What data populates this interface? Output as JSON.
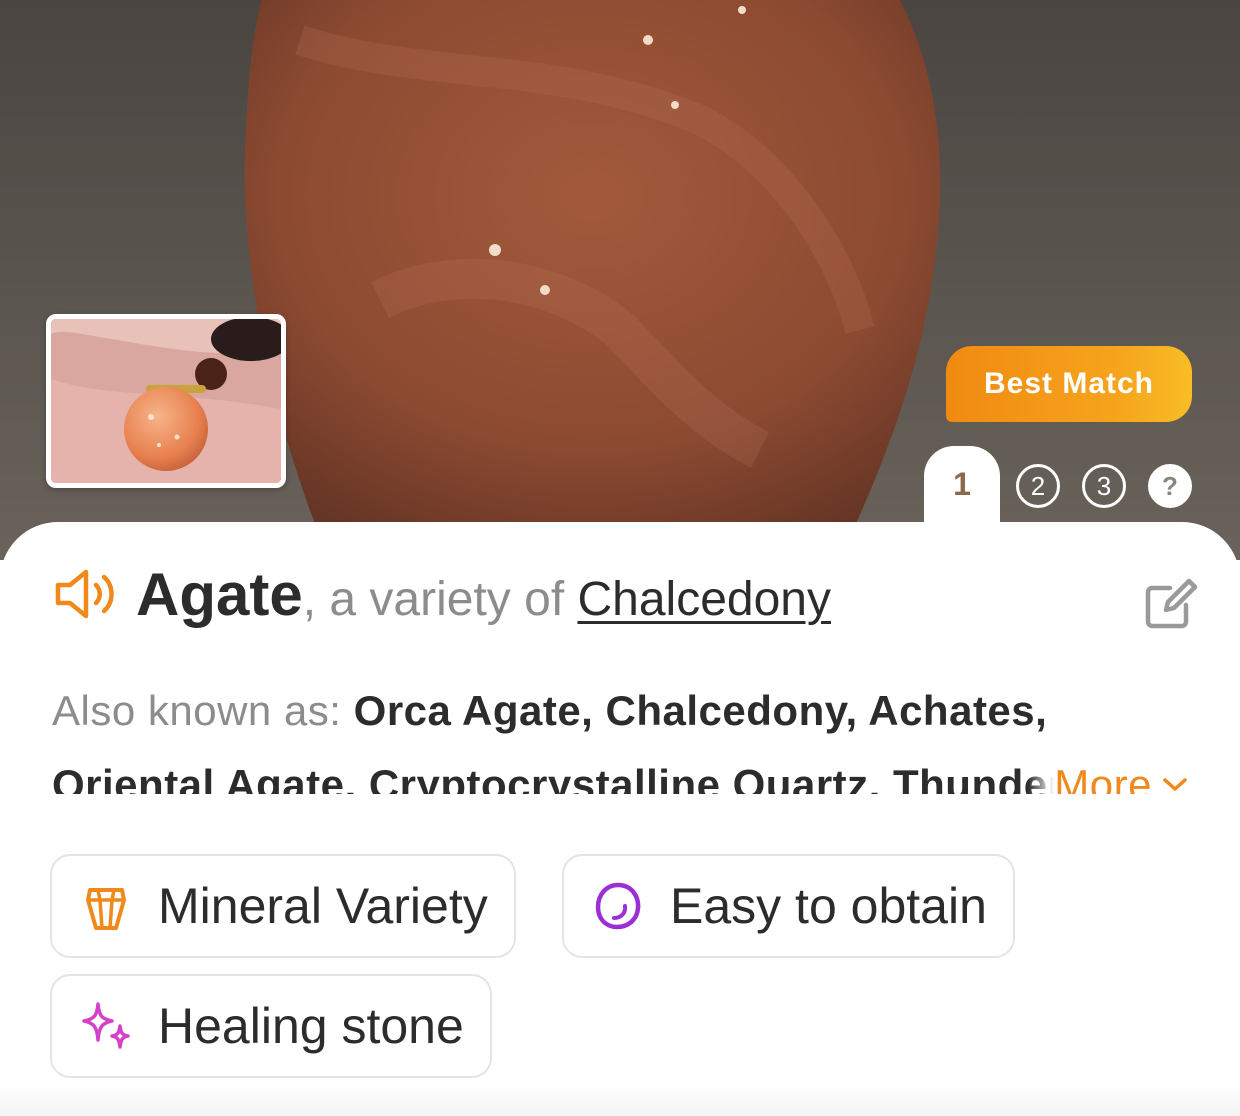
{
  "hero": {
    "badge_label": "Best Match",
    "tabs": [
      {
        "label": "1",
        "active": true
      },
      {
        "label": "2",
        "active": false
      },
      {
        "label": "3",
        "active": false
      },
      {
        "label": "?",
        "active": false
      }
    ]
  },
  "result": {
    "name": "Agate",
    "separator": ", a variety of ",
    "parent": "Chalcedony",
    "aka_label": "Also known as: ",
    "aka_values": "Orca Agate, Chalcedony, Achates, Oriental Agate, Cryptocrystalline Quartz, Thunder Egg, Moss Agate",
    "more_label": "More"
  },
  "tags": [
    {
      "label": "Mineral Variety",
      "icon": "gem-icon",
      "color": "#f0881a"
    },
    {
      "label": "Easy to obtain",
      "icon": "stone-icon",
      "color": "#9b2fd6"
    },
    {
      "label": "Healing stone",
      "icon": "sparkle-icon",
      "color": "#d63fc8"
    }
  ],
  "colors": {
    "accent": "#f0881a",
    "text": "#2c2c2c",
    "muted": "#8c8c8c"
  }
}
